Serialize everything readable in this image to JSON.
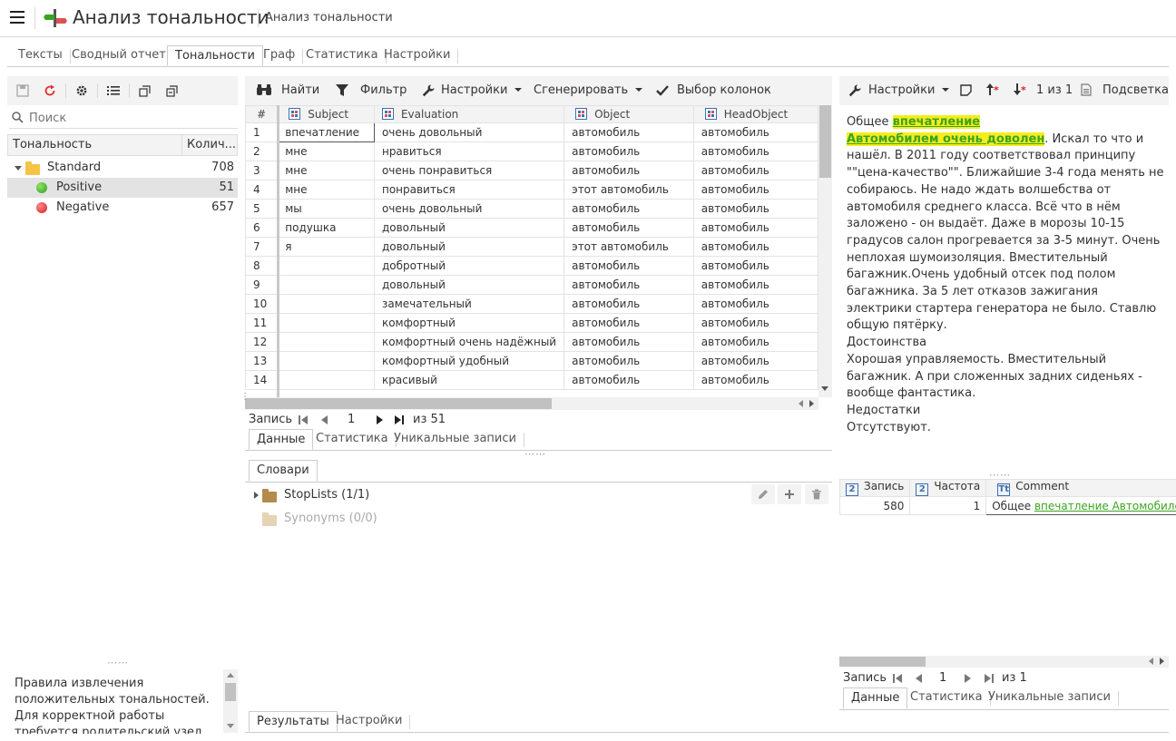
{
  "header": {
    "app_title": "Анализ тональности",
    "breadcrumb": "Анализ тональности"
  },
  "main_tabs": [
    {
      "label": "Тексты"
    },
    {
      "label": "Сводный отчет"
    },
    {
      "label": "Тональности",
      "active": true
    },
    {
      "label": "Граф"
    },
    {
      "label": "Статистика"
    },
    {
      "label": "Настройки"
    }
  ],
  "left_panel": {
    "search_placeholder": "Поиск",
    "tree_columns": [
      "Тональность",
      "Колич..."
    ],
    "tree": [
      {
        "label": "Standard",
        "count": "708",
        "type": "folder"
      },
      {
        "label": "Positive",
        "count": "51",
        "type": "positive",
        "selected": true
      },
      {
        "label": "Negative",
        "count": "657",
        "type": "negative"
      }
    ],
    "description": "Правила извлечения положительных тональностей. Для корректной работы требуется родительский узел Извлечение"
  },
  "grid_toolbar": {
    "find": "Найти",
    "filter": "Фильтр",
    "settings": "Настройки",
    "generate": "Сгенерировать",
    "columns": "Выбор колонок"
  },
  "grid": {
    "columns": [
      "#",
      "Subject",
      "Evaluation",
      "Object",
      "HeadObject"
    ],
    "rows": [
      [
        "1",
        "впечатление",
        "очень довольный",
        "автомобиль",
        "автомобиль"
      ],
      [
        "2",
        "мне",
        "нравиться",
        "автомобиль",
        "автомобиль"
      ],
      [
        "3",
        "мне",
        "очень понравиться",
        "автомобиль",
        "автомобиль"
      ],
      [
        "4",
        "мне",
        "понравиться",
        "этот автомобиль",
        "автомобиль"
      ],
      [
        "5",
        "мы",
        "очень довольный",
        "автомобиль",
        "автомобиль"
      ],
      [
        "6",
        "подушка",
        "довольный",
        "автомобиль",
        "автомобиль"
      ],
      [
        "7",
        "я",
        "довольный",
        "этот автомобиль",
        "автомобиль"
      ],
      [
        "8",
        "",
        "добротный",
        "автомобиль",
        "автомобиль"
      ],
      [
        "9",
        "",
        "довольный",
        "автомобиль",
        "автомобиль"
      ],
      [
        "10",
        "",
        "замечательный",
        "автомобиль",
        "автомобиль"
      ],
      [
        "11",
        "",
        "комфортный",
        "автомобиль",
        "автомобиль"
      ],
      [
        "12",
        "",
        "комфортный очень надёжный",
        "автомобиль",
        "автомобиль"
      ],
      [
        "13",
        "",
        "комфортный удобный",
        "автомобиль",
        "автомобиль"
      ],
      [
        "14",
        "",
        "красивый",
        "автомобиль",
        "автомобиль"
      ]
    ],
    "pager": {
      "label": "Запись",
      "current": "1",
      "of": "из 51"
    },
    "subtabs": [
      {
        "label": "Данные",
        "active": true
      },
      {
        "label": "Статистика"
      },
      {
        "label": "Уникальные записи"
      }
    ]
  },
  "dictionaries": {
    "tab": "Словари",
    "items": [
      {
        "label": "StopLists (1/1)",
        "enabled": true
      },
      {
        "label": "Synonyms (0/0)",
        "enabled": false
      }
    ]
  },
  "bottom_tabs": [
    {
      "label": "Результаты",
      "active": true
    },
    {
      "label": "Настройки"
    }
  ],
  "right_panel": {
    "toolbar": {
      "settings": "Настройки",
      "pages": "1 из 1",
      "highlight": "Подсветка"
    },
    "text_parts": [
      {
        "t": "Общее ",
        "hl": false
      },
      {
        "t": "впечатление",
        "hl": true
      },
      {
        "t": "\n",
        "hl": false
      },
      {
        "t": "Автомобилем очень доволен",
        "hl": true
      },
      {
        "t": ". Искал то что и нашёл. В 2011 году соответствовал принципу \"\"цена-качество\"\". Ближайшие 3-4 года менять не собираюсь. Не надо ждать волшебства от автомобиля среднего класса. Всё что в нём заложено - он выдаёт. Даже в морозы 10-15 градусов салон прогревается за 3-5 минут. Очень неплохая шумоизоляция. Вместительный багажник.Очень удобный отсек под полом багажника. За 5 лет отказов зажигания электрики стартера генератора не было. Ставлю общую пятёрку.\nДостоинства\nХорошая управляемость. Вместительный багажник. А при сложенных задних сиденьях - вообще фантастика.\nНедостатки\nОтсутствуют.",
        "hl": false
      }
    ],
    "grid_columns": [
      "Запись",
      "Частота",
      "Comment"
    ],
    "grid_row": {
      "record": "580",
      "freq": "1",
      "comment_prefix": "Общее ",
      "comment_link": "впечатление Автомобилем очень доволен"
    },
    "pager": {
      "label": "Запись",
      "current": "1",
      "of": "из 1"
    },
    "subtabs": [
      {
        "label": "Данные",
        "active": true
      },
      {
        "label": "Статистика"
      },
      {
        "label": "Уникальные записи"
      }
    ]
  }
}
